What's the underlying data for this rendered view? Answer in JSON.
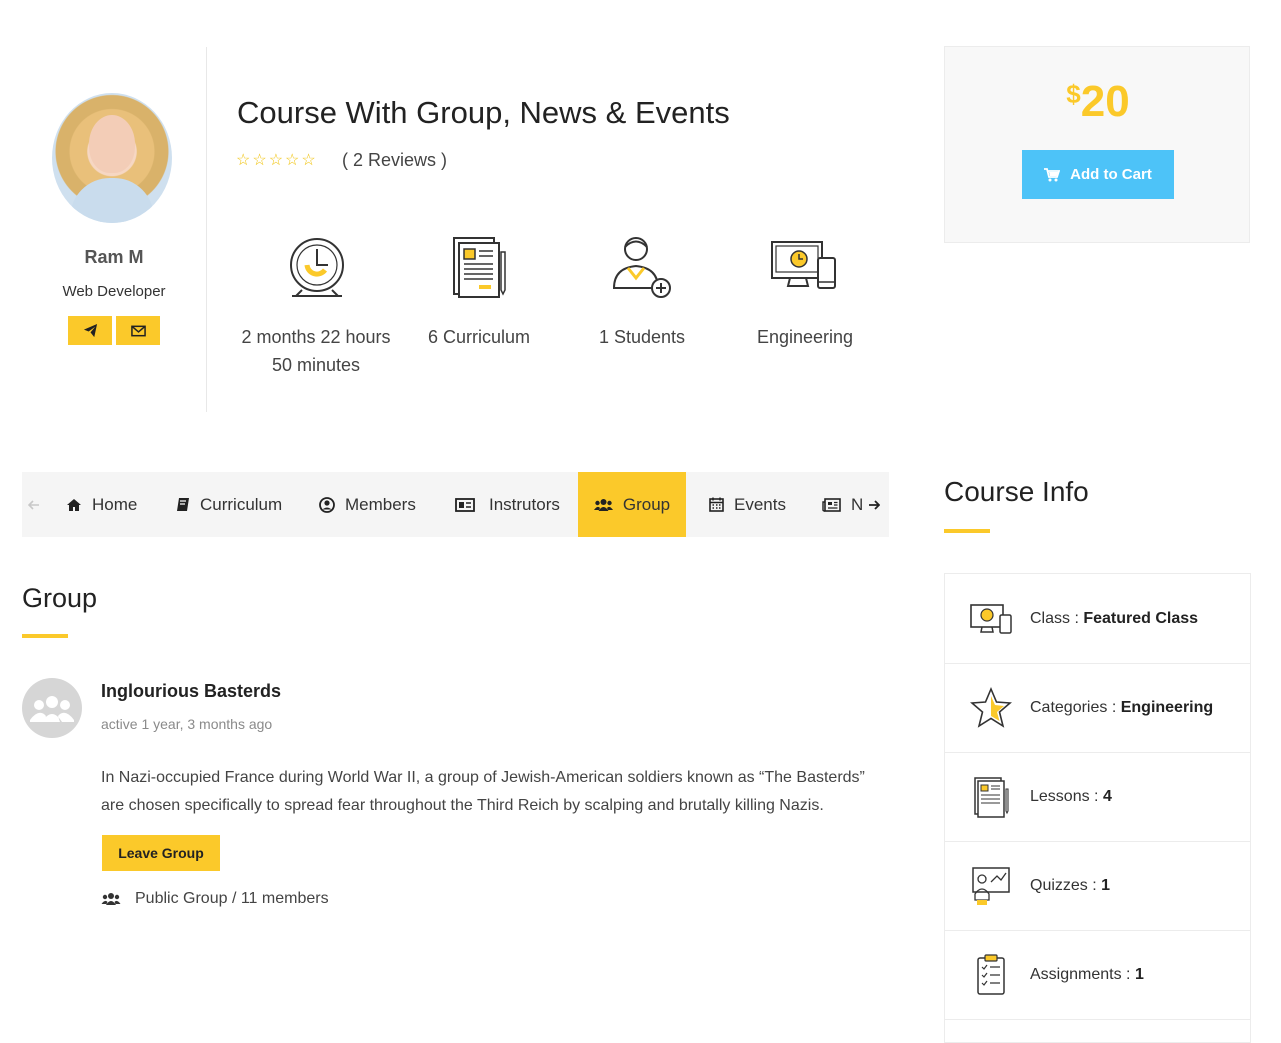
{
  "instructor": {
    "name": "Ram M",
    "role": "Web Developer",
    "buttons": [
      {
        "icon": "paper-plane-icon"
      },
      {
        "icon": "envelope-icon"
      }
    ]
  },
  "course": {
    "title": "Course With Group, News & Events",
    "stars": "☆☆☆☆☆",
    "rating": 0,
    "reviews": "( 2 Reviews )",
    "meta": [
      {
        "icon": "clock-icon",
        "line1": "2 months 22 hours",
        "line2": "50 minutes"
      },
      {
        "icon": "curriculum-document-icon",
        "line1": "6 Curriculum",
        "line2": ""
      },
      {
        "icon": "student-add-icon",
        "line1": "1 Students",
        "line2": ""
      },
      {
        "icon": "devices-category-icon",
        "line1": "Engineering",
        "line2": ""
      }
    ]
  },
  "pricing": {
    "currency": "$",
    "amount": "20",
    "add_to_cart": "Add to Cart"
  },
  "tabs": [
    {
      "label": "Home",
      "icon": "home-icon",
      "active": false
    },
    {
      "label": "Curriculum",
      "icon": "book-icon",
      "active": false
    },
    {
      "label": "Members",
      "icon": "user-circle-icon",
      "active": false
    },
    {
      "label": "Instrutors",
      "icon": "id-card-icon",
      "active": false
    },
    {
      "label": "Group",
      "icon": "users-icon",
      "active": true
    },
    {
      "label": "Events",
      "icon": "calendar-icon",
      "active": false
    },
    {
      "label": "N",
      "icon": "newspaper-icon",
      "active": false
    }
  ],
  "group_section": {
    "title": "Group",
    "group": {
      "name": "Inglourious Basterds",
      "active": "active 1 year, 3 months ago",
      "description": "In Nazi-occupied France during World War II, a group of Jewish-American soldiers known as “The Basterds” are chosen specifically to spread fear throughout the Third Reich by scalping and brutally killing Nazis.",
      "leave_button": "Leave Group",
      "meta": "Public Group / 11 members"
    }
  },
  "course_info": {
    "title": "Course Info",
    "rows": [
      {
        "icon": "class-devices-icon",
        "label": "Class : ",
        "value": "Featured Class"
      },
      {
        "icon": "star-icon",
        "label": "Categories : ",
        "value": "Engineering"
      },
      {
        "icon": "lessons-document-icon",
        "label": "Lessons : ",
        "value": "4"
      },
      {
        "icon": "quiz-presentation-icon",
        "label": "Quizzes : ",
        "value": "1"
      },
      {
        "icon": "assignment-clipboard-icon",
        "label": "Assignments : ",
        "value": "1"
      }
    ]
  },
  "colors": {
    "accent": "#fbc92a",
    "button_blue": "#4dc3f8"
  }
}
